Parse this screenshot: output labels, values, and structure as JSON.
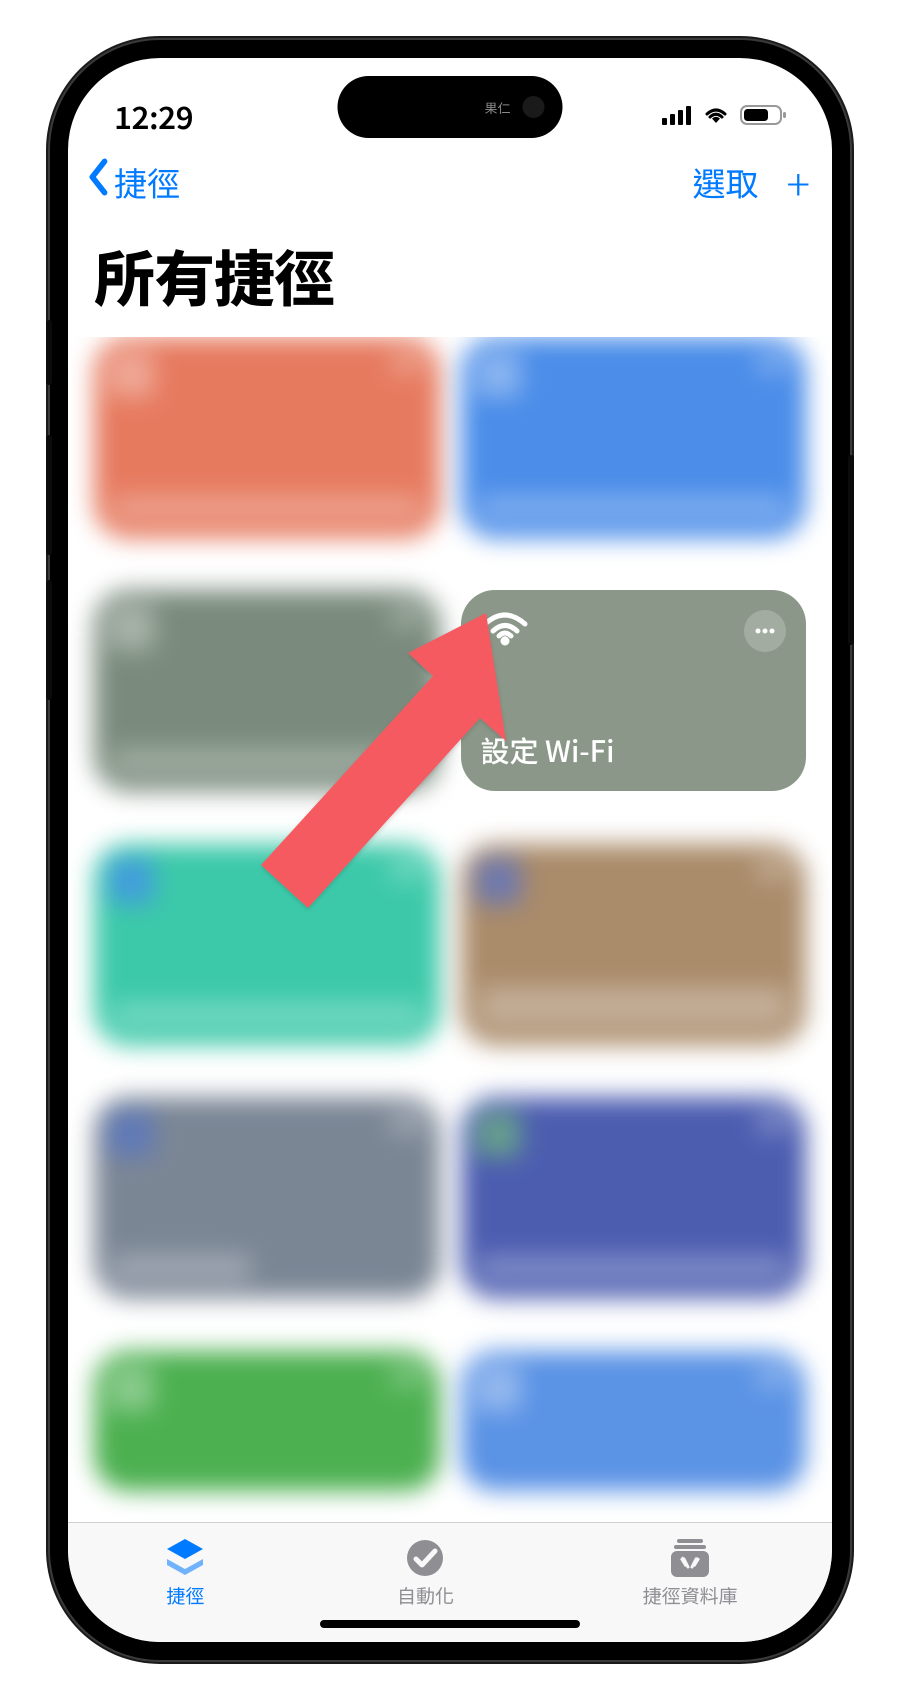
{
  "statusbar": {
    "time": "12:29"
  },
  "navbar": {
    "back_label": "捷徑",
    "select_label": "選取",
    "add_label": "+"
  },
  "page_title": "所有捷徑",
  "shortcuts": [
    {
      "color": "#e67a5f",
      "obscured": true
    },
    {
      "color": "#4b8de9",
      "obscured": true
    },
    {
      "color": "#7a8b7d",
      "obscured": true
    },
    {
      "color": "#8b9889",
      "obscured": false,
      "label": "設定 Wi-Fi",
      "icon": "wifi"
    },
    {
      "color": "#3cc9a9",
      "obscured": true
    },
    {
      "color": "#aa8b6a",
      "obscured": true
    },
    {
      "color": "#7b8695",
      "obscured": true
    },
    {
      "color": "#4c5db0",
      "obscured": true
    },
    {
      "color": "#4cb050",
      "obscured": true,
      "partial": true
    },
    {
      "color": "#5b93e5",
      "obscured": true,
      "partial": true
    }
  ],
  "tabs": [
    {
      "label": "捷徑",
      "active": true,
      "icon": "shortcuts"
    },
    {
      "label": "自動化",
      "active": false,
      "icon": "clock-check"
    },
    {
      "label": "捷徑資料庫",
      "active": false,
      "icon": "gallery"
    }
  ]
}
